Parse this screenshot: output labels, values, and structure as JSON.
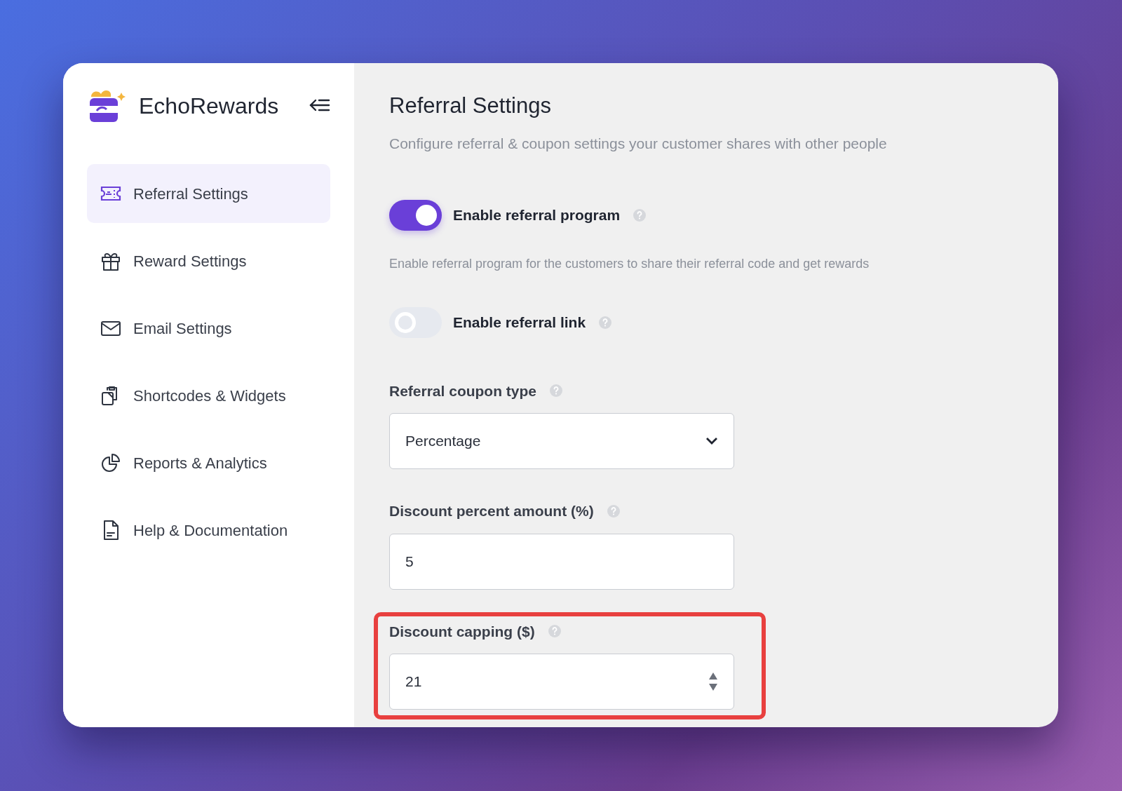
{
  "sidebar": {
    "brand": "EchoRewards",
    "items": [
      {
        "label": "Referral Settings",
        "selected": true
      },
      {
        "label": "Reward Settings",
        "selected": false
      },
      {
        "label": "Email Settings",
        "selected": false
      },
      {
        "label": "Shortcodes & Widgets",
        "selected": false
      },
      {
        "label": "Reports & Analytics",
        "selected": false
      },
      {
        "label": "Help & Documentation",
        "selected": false
      }
    ]
  },
  "page": {
    "title": "Referral Settings",
    "subtitle": "Configure referral & coupon settings your customer shares with other people"
  },
  "toggles": [
    {
      "label": "Enable referral program",
      "on": true,
      "description": "Enable referral program for the customers to share their referral code and get rewards"
    },
    {
      "label": "Enable referral link",
      "on": false
    }
  ],
  "fields": [
    {
      "kind": "select",
      "label": "Referral coupon type",
      "value": "Percentage",
      "highlighted": false
    },
    {
      "kind": "text",
      "label": "Discount percent amount (%)",
      "value": "5",
      "highlighted": false
    },
    {
      "kind": "number",
      "label": "Discount capping ($)",
      "value": "21",
      "highlighted": true
    }
  ]
}
